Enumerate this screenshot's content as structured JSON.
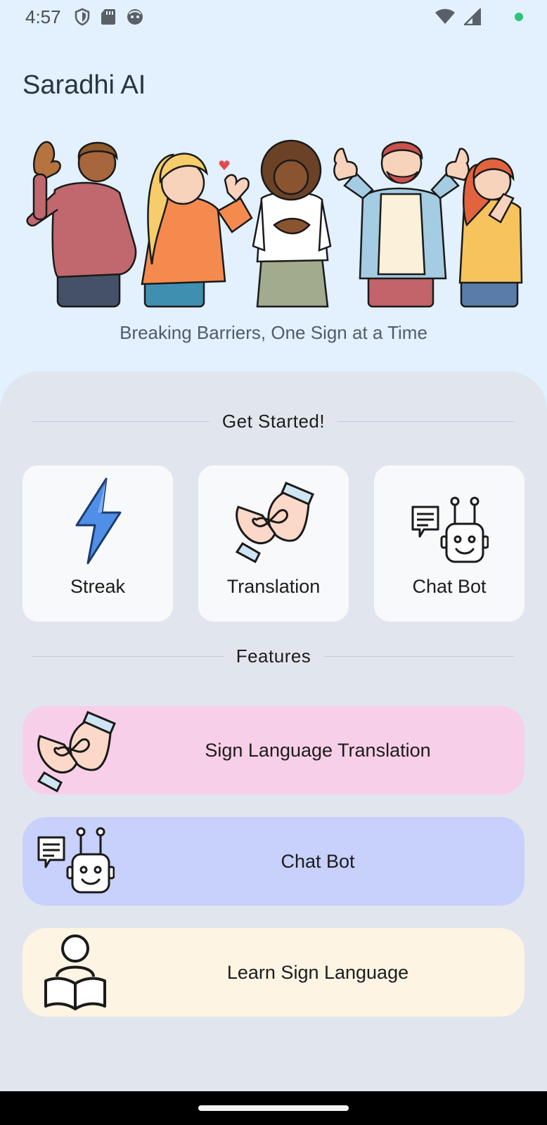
{
  "status": {
    "time": "4:57"
  },
  "app": {
    "title": "Saradhi AI",
    "tagline": "Breaking Barriers, One Sign at a Time"
  },
  "get_started": {
    "heading": "Get Started!",
    "cards": [
      {
        "label": "Streak",
        "icon": "lightning-icon"
      },
      {
        "label": "Translation",
        "icon": "sign-hands-icon"
      },
      {
        "label": "Chat Bot",
        "icon": "robot-icon"
      }
    ]
  },
  "features": {
    "heading": "Features",
    "items": [
      {
        "label": "Sign Language Translation",
        "icon": "sign-hands-icon",
        "color": "#f8cfe8"
      },
      {
        "label": "Chat Bot",
        "icon": "robot-icon",
        "color": "#c8d0fc"
      },
      {
        "label": "Learn Sign Language",
        "icon": "reader-book-icon",
        "color": "#fdf4e4"
      }
    ]
  },
  "colors": {
    "background": "#e2f1fd",
    "panel": "#e1e6ee",
    "card": "#f7f9fb",
    "status_dot": "#2ec27e"
  }
}
